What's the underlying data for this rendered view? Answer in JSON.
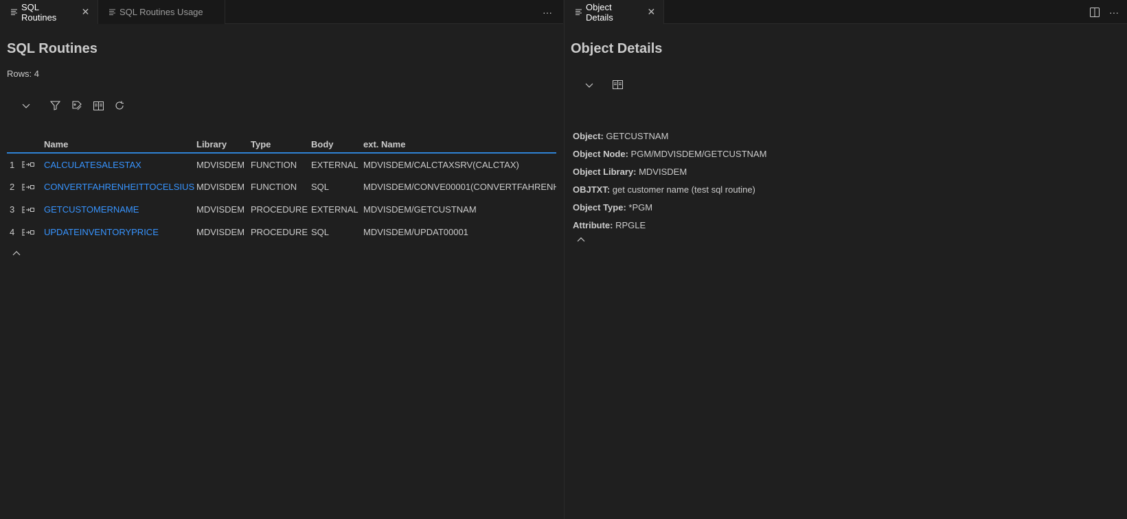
{
  "left": {
    "tabs": [
      {
        "label": "SQL Routines",
        "active": true
      },
      {
        "label": "SQL Routines Usage",
        "active": false
      }
    ],
    "title": "SQL Routines",
    "rows_label": "Rows: 4",
    "table": {
      "columns": [
        "Name",
        "Library",
        "Type",
        "Body",
        "ext. Name"
      ],
      "rows": [
        {
          "num": "1",
          "name": "CALCULATESALESTAX",
          "library": "MDVISDEM",
          "type": "FUNCTION",
          "body": "EXTERNAL",
          "ext_name": "MDVISDEM/CALCTAXSRV(CALCTAX)"
        },
        {
          "num": "2",
          "name": "CONVERTFAHRENHEITTOCELSIUS",
          "library": "MDVISDEM",
          "type": "FUNCTION",
          "body": "SQL",
          "ext_name": "MDVISDEM/CONVE00001(CONVERTFAHRENH"
        },
        {
          "num": "3",
          "name": "GETCUSTOMERNAME",
          "library": "MDVISDEM",
          "type": "PROCEDURE",
          "body": "EXTERNAL",
          "ext_name": "MDVISDEM/GETCUSTNAM"
        },
        {
          "num": "4",
          "name": "UPDATEINVENTORYPRICE",
          "library": "MDVISDEM",
          "type": "PROCEDURE",
          "body": "SQL",
          "ext_name": "MDVISDEM/UPDAT00001"
        }
      ]
    },
    "more_actions": "···"
  },
  "right": {
    "tabs": [
      {
        "label": "Object Details",
        "active": true
      }
    ],
    "title": "Object Details",
    "details": [
      {
        "label": "Object:",
        "value": "GETCUSTNAM"
      },
      {
        "label": "Object Node:",
        "value": "PGM/MDVISDEM/GETCUSTNAM"
      },
      {
        "label": "Object Library:",
        "value": "MDVISDEM"
      },
      {
        "label": "OBJTXT:",
        "value": "get customer name (test sql routine)"
      },
      {
        "label": "Object Type:",
        "value": "*PGM"
      },
      {
        "label": "Attribute:",
        "value": "RPGLE"
      }
    ],
    "more_actions": "···"
  },
  "colors": {
    "background": "#1f1f1f",
    "tabbar": "#181818",
    "link": "#3794ff",
    "accent": "#2f83d5"
  }
}
